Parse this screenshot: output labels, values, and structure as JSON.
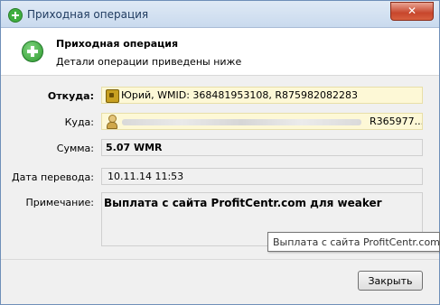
{
  "window": {
    "title": "Приходная операция",
    "close_label": "✕"
  },
  "header": {
    "title": "Приходная операция",
    "subtitle": "Детали операции приведены ниже"
  },
  "fields": {
    "from_label": "Откуда:",
    "from_value": "Юрий, WMID: 368481953108, R875982082283",
    "to_label": "Куда:",
    "to_value_suffix": "R365977...",
    "amount_label": "Сумма:",
    "amount_value": "5.07 WMR",
    "date_label": "Дата перевода:",
    "date_value": "10.11.14 11:53",
    "note_label": "Примечание:",
    "note_value": "Выплата с сайта ProfitCentr.com для weaker"
  },
  "tooltip": {
    "text": "Выплата с сайта ProfitCentr.com д"
  },
  "footer": {
    "close_button": "Закрыть"
  },
  "icons": {
    "title_icon": "add-circle-icon",
    "header_icon": "add-circle-icon",
    "from_icon": "wallet-icon",
    "to_icon": "user-icon"
  },
  "colors": {
    "accent_green": "#3fae3f",
    "close_red": "#c7462c",
    "field_yellow": "#fdf8d6"
  }
}
